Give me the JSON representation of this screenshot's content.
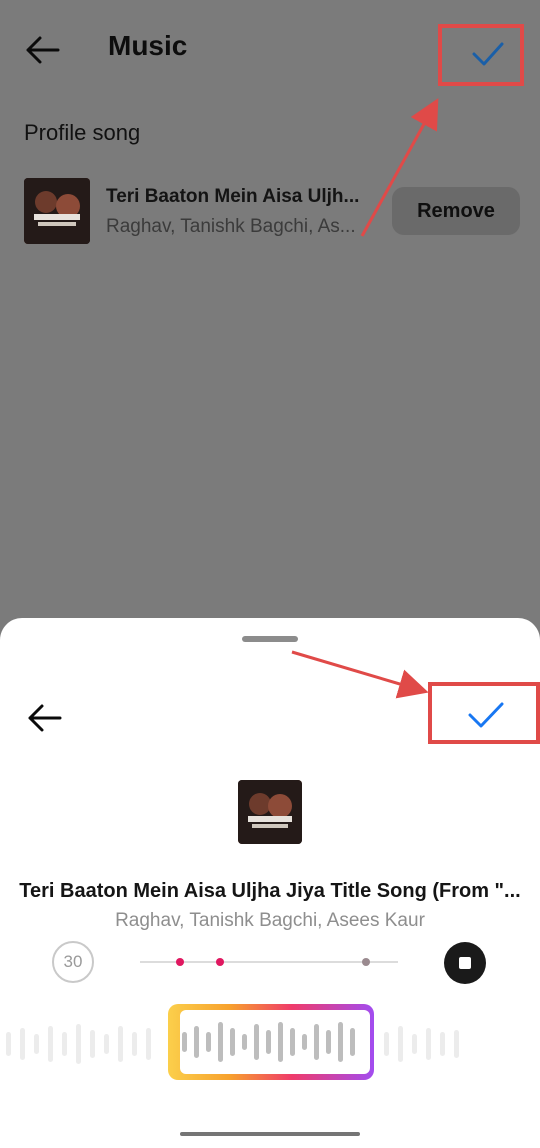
{
  "header": {
    "title": "Music"
  },
  "profile": {
    "section_title": "Profile song",
    "song": {
      "title": "Teri Baaton Mein Aisa Uljh...",
      "artists": "Raghav, Tanishk Bagchi, As...",
      "remove_label": "Remove"
    }
  },
  "sheet": {
    "song_title": "Teri Baaton Mein Aisa Uljha Jiya Title Song (From \"...",
    "song_artists": "Raghav, Tanishk Bagchi, Asees Kaur",
    "duration_label": "30"
  },
  "icons": {
    "back": "arrow-left-icon",
    "confirm": "checkmark-icon",
    "stop": "stop-icon"
  },
  "colors": {
    "accent": "#1877f2",
    "highlight": "#e04a48",
    "dot": "#e01860"
  }
}
